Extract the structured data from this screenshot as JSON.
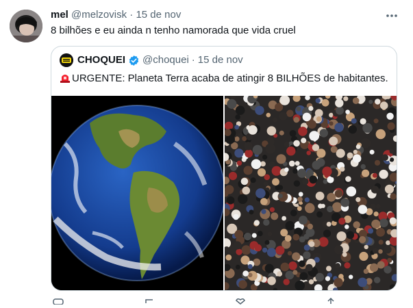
{
  "tweet": {
    "display_name": "mel",
    "handle": "@melzovisk",
    "separator": "·",
    "date": "15 de nov",
    "text": "8 bilhões e eu ainda n tenho namorada que vida cruel",
    "more_icon": "more-horizontal-icon"
  },
  "quote": {
    "display_name": "CHOQUEI",
    "handle": "@choquei",
    "separator": "·",
    "date": "15 de nov",
    "verified_icon": "verified-badge-icon",
    "siren_icon": "police-light-icon",
    "text": "URGENTE: Planeta Terra acaba de atingir 8 BILHÕES de habitantes.",
    "media": [
      {
        "name": "earth-image",
        "description_icon": "earth-globe"
      },
      {
        "name": "crowd-image",
        "description_icon": "crowd"
      }
    ]
  },
  "colors": {
    "text": "#0f1419",
    "muted": "#536471",
    "border": "#cfd9de",
    "verified": "#1d9bf0",
    "siren": "#f4212e"
  }
}
